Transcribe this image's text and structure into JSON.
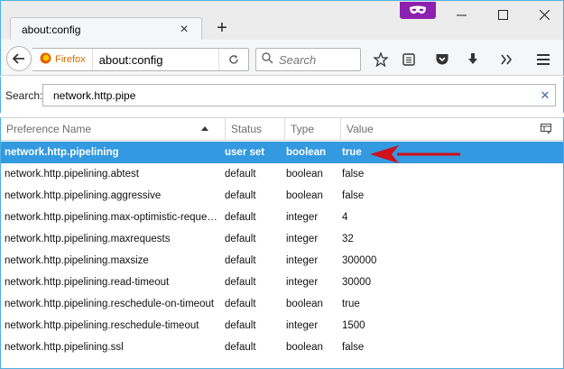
{
  "tab": {
    "title": "about:config"
  },
  "urlbar": {
    "identity_label": "Firefox",
    "url": "about:config"
  },
  "searchbar": {
    "placeholder": "Search"
  },
  "filter": {
    "label": "Search:",
    "value": "network.http.pipe"
  },
  "columns": [
    "Preference Name",
    "Status",
    "Type",
    "Value"
  ],
  "rows": [
    {
      "name": "network.http.pipelining",
      "status": "user set",
      "type": "boolean",
      "value": "true"
    },
    {
      "name": "network.http.pipelining.abtest",
      "status": "default",
      "type": "boolean",
      "value": "false"
    },
    {
      "name": "network.http.pipelining.aggressive",
      "status": "default",
      "type": "boolean",
      "value": "false"
    },
    {
      "name": "network.http.pipelining.max-optimistic-requests",
      "status": "default",
      "type": "integer",
      "value": "4"
    },
    {
      "name": "network.http.pipelining.maxrequests",
      "status": "default",
      "type": "integer",
      "value": "32"
    },
    {
      "name": "network.http.pipelining.maxsize",
      "status": "default",
      "type": "integer",
      "value": "300000"
    },
    {
      "name": "network.http.pipelining.read-timeout",
      "status": "default",
      "type": "integer",
      "value": "30000"
    },
    {
      "name": "network.http.pipelining.reschedule-on-timeout",
      "status": "default",
      "type": "boolean",
      "value": "true"
    },
    {
      "name": "network.http.pipelining.reschedule-timeout",
      "status": "default",
      "type": "integer",
      "value": "1500"
    },
    {
      "name": "network.http.pipelining.ssl",
      "status": "default",
      "type": "boolean",
      "value": "false"
    }
  ],
  "selected_row": 0,
  "colors": {
    "selection": "#3399e0",
    "private_badge": "#8d20ae",
    "annotation_arrow": "#d0101a",
    "firefox_label": "#d76e00"
  },
  "icons": [
    "close-tab-icon",
    "new-tab-icon",
    "private-browsing-icon",
    "minimize-icon",
    "maximize-icon",
    "close-window-icon",
    "back-icon",
    "firefox-icon",
    "reload-icon",
    "search-icon",
    "bookmark-star-icon",
    "reader-list-icon",
    "pocket-icon",
    "download-icon",
    "overflow-icon",
    "menu-icon",
    "clear-icon",
    "sort-ascending-icon",
    "column-picker-icon"
  ]
}
